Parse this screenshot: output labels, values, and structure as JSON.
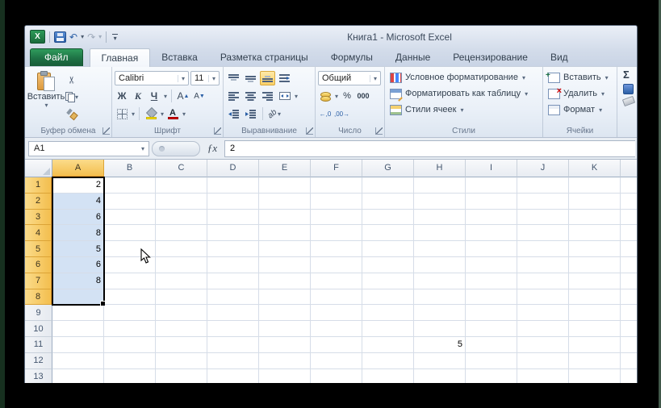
{
  "window": {
    "title": "Книга1  - Microsoft Excel"
  },
  "icons": {
    "excel_logo": "X",
    "scissors": "✂",
    "undo": "↶",
    "redo": "↷",
    "dropdown": "▾",
    "sigma": "Σ",
    "fx": "ƒx",
    "bold": "Ж",
    "italic": "К",
    "underline": "Ч",
    "grow_font": "А",
    "shrink_font": "А",
    "font_color_letter": "А",
    "percent": "%",
    "thousands": "000",
    "inc_decimal": "←,0",
    "dec_decimal": ",00→",
    "orientation_ab": "ab"
  },
  "tabs": {
    "file": "Файл",
    "items": [
      {
        "label": "Главная",
        "active": true
      },
      {
        "label": "Вставка"
      },
      {
        "label": "Разметка страницы"
      },
      {
        "label": "Формулы"
      },
      {
        "label": "Данные"
      },
      {
        "label": "Рецензирование"
      },
      {
        "label": "Вид"
      }
    ]
  },
  "ribbon": {
    "clipboard": {
      "group": "Буфер обмена",
      "paste": "Вставить"
    },
    "font": {
      "group": "Шрифт",
      "family": "Calibri",
      "size": "11"
    },
    "alignment": {
      "group": "Выравнивание"
    },
    "number": {
      "group": "Число",
      "format": "Общий"
    },
    "styles": {
      "group": "Стили",
      "items": [
        {
          "label": "Условное форматирование"
        },
        {
          "label": "Форматировать как таблицу"
        },
        {
          "label": "Стили ячеек"
        }
      ]
    },
    "cells": {
      "group": "Ячейки",
      "items": [
        {
          "label": "Вставить"
        },
        {
          "label": "Удалить"
        },
        {
          "label": "Формат"
        }
      ]
    }
  },
  "formula_bar": {
    "name_box": "A1",
    "value": "2"
  },
  "sheet": {
    "columns": [
      "A",
      "B",
      "C",
      "D",
      "E",
      "F",
      "G",
      "H",
      "I",
      "J",
      "K"
    ],
    "selected_column": "A",
    "rows": 13,
    "selected_rows_from": 1,
    "selected_rows_to": 8,
    "selection_range": "A1:A8",
    "active_cell": "A1",
    "cells": {
      "A1": "2",
      "A2": "4",
      "A3": "6",
      "A4": "8",
      "A5": "5",
      "A6": "6",
      "A7": "8",
      "H11": "5"
    }
  },
  "colors": {
    "file_tab_green": "#1E7145",
    "selection_fill": "#D3E2F4",
    "selected_header": "#F3BE4E",
    "grid_line": "#D6DDE8"
  }
}
